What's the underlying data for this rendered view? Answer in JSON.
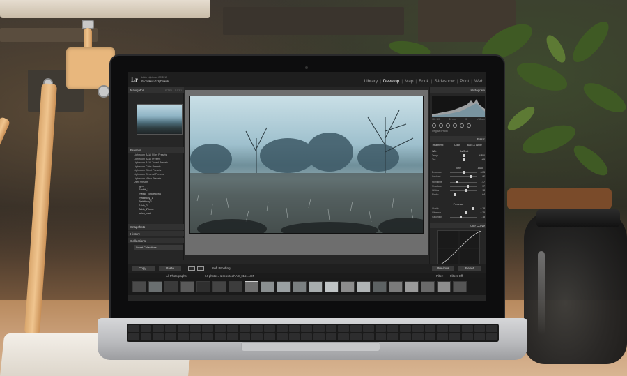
{
  "lightroom": {
    "app_logo": "Lr",
    "brand_line1": "Adobe Lightroom CC 2015",
    "brand_line2": "Radosław Grzybowski",
    "modules": [
      "Library",
      "Develop",
      "Map",
      "Book",
      "Slideshow",
      "Print",
      "Web"
    ],
    "active_module": "Develop",
    "left_panel": {
      "navigator": "Navigator",
      "navigator_zoom": "FIT  FILL  1:1  3:1",
      "presets": "Presets",
      "preset_items": [
        "Lightroom B&W Filter Presets",
        "Lightroom B&W Presets",
        "Lightroom B&W Toned Presets",
        "Lightroom Color Presets",
        "Lightroom Effect Presets",
        "Lightroom General Presets",
        "Lightroom Video Presets",
        "User Presets"
      ],
      "user_presets": [
        "fgvn",
        "Radek_1",
        "Rybnik_Einkreowna",
        "Rydultowy_1",
        "Rydultowy2",
        "Szkło_2",
        "Tablo_iPhone",
        "turico_matt"
      ],
      "snapshots": "Snapshots",
      "history": "History",
      "collections": "Collections",
      "smart_collections": "Smart Collections"
    },
    "toolbar": {
      "copy": "Copy...",
      "paste": "Paste",
      "soft_proofing": "Soft Proofing",
      "previous": "Previous",
      "reset": "Reset"
    },
    "right_panel": {
      "histogram": "Histogram",
      "hist_values": [
        "ISO 100",
        "24 mm",
        "f/8",
        "1/30 sec"
      ],
      "original_photo": "Original Photo",
      "basic": "Basic",
      "treatment_label": "Treatment:",
      "treatment_color": "Color",
      "treatment_bw": "Black & White",
      "wb_label": "WB:",
      "wb_value": "As Shot",
      "tone_label": "Tone",
      "tone_auto": "Auto",
      "presence_label": "Presence",
      "tone_curve": "Tone Curve",
      "sliders": [
        {
          "label": "Temp",
          "value": "4 850",
          "level": 0.55
        },
        {
          "label": "Tint",
          "value": "+ 9",
          "level": 0.52
        },
        {
          "label": "Exposure",
          "value": "+ 0.25",
          "level": 0.54
        },
        {
          "label": "Contrast",
          "value": "+ 62",
          "level": 0.78
        },
        {
          "label": "Highlights",
          "value": "- 47",
          "level": 0.28
        },
        {
          "label": "Shadows",
          "value": "+ 37",
          "level": 0.66
        },
        {
          "label": "Whites",
          "value": "+ 18",
          "level": 0.58
        },
        {
          "label": "Blacks",
          "value": "- 64",
          "level": 0.2
        },
        {
          "label": "Clarity",
          "value": "+ 78",
          "level": 0.86
        },
        {
          "label": "Vibrance",
          "value": "+ 25",
          "level": 0.6
        },
        {
          "label": "Saturation",
          "value": "- 18",
          "level": 0.42
        }
      ]
    },
    "filmstrip_info": {
      "source": "All Photographs",
      "count": "64 photos / 1 selected",
      "filename": "/RAD_0151.NEF",
      "filter_label": "Filter:",
      "filter_value": "Filters Off"
    }
  },
  "colors": {
    "lr_background": "#262626",
    "lr_panel_head": "#313131",
    "active_text": "#f2f2f2"
  }
}
